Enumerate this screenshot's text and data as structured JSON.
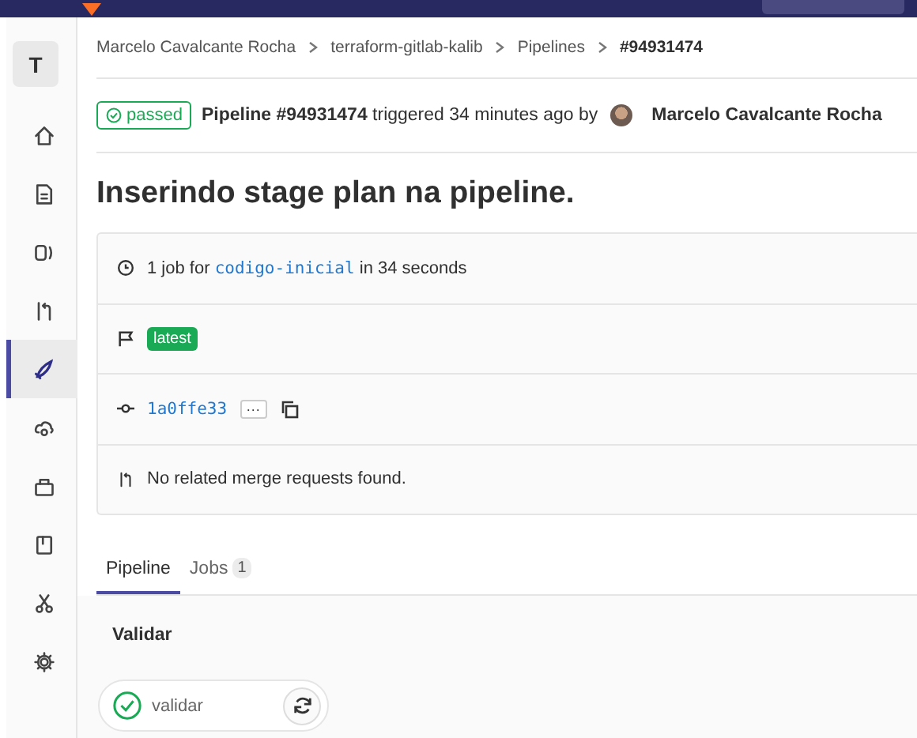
{
  "project_avatar": "T",
  "sidebar": {
    "items": [
      {
        "selected": false
      },
      {
        "selected": false
      },
      {
        "selected": false
      },
      {
        "selected": false
      },
      {
        "selected": true
      },
      {
        "selected": false
      },
      {
        "selected": false
      },
      {
        "selected": false
      },
      {
        "selected": false
      },
      {
        "selected": false
      }
    ]
  },
  "breadcrumbs": [
    {
      "label": "Marcelo Cavalcante Rocha",
      "current": false
    },
    {
      "label": "terraform-gitlab-kalib",
      "current": false
    },
    {
      "label": "Pipelines",
      "current": false
    },
    {
      "label": "#94931474",
      "current": true
    }
  ],
  "header": {
    "status": "passed",
    "summary": "**Pipeline #94931474** triggered 34 minutes ago by",
    "author": "Marcelo Cavalcante Rocha"
  },
  "title": "Inserindo stage plan na pipeline.",
  "info_rows": [
    {
      "kind": "duration",
      "prefix": "1 job for",
      "branch": "codigo-inicial",
      "suffix": "in 34 seconds"
    },
    {
      "kind": "tags",
      "tags": [
        "latest"
      ]
    },
    {
      "kind": "commit",
      "sha": "1a0ffe33",
      "more": "···"
    },
    {
      "kind": "merge",
      "text": "No related merge requests found."
    }
  ],
  "tabs": [
    {
      "label": "Pipeline",
      "selected": true
    },
    {
      "label": "Jobs",
      "count": "1",
      "selected": false
    }
  ],
  "stages": [
    {
      "name": "Validar",
      "jobs": [
        {
          "name": "validar"
        }
      ]
    }
  ]
}
